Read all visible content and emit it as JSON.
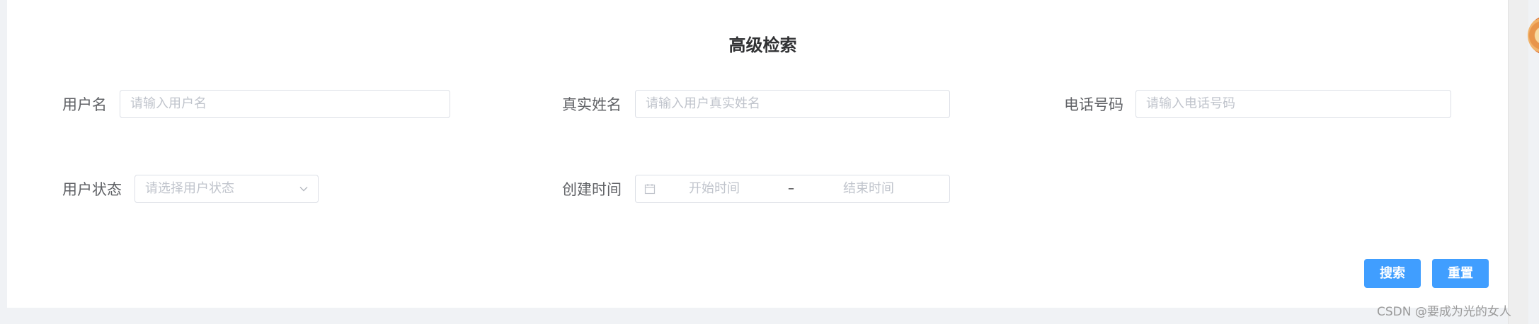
{
  "form": {
    "title": "高级检索",
    "username": {
      "label": "用户名",
      "placeholder": "请输入用户名"
    },
    "realname": {
      "label": "真实姓名",
      "placeholder": "请输入用户真实姓名"
    },
    "phone": {
      "label": "电话号码",
      "placeholder": "请输入电话号码"
    },
    "status": {
      "label": "用户状态",
      "placeholder": "请选择用户状态"
    },
    "created": {
      "label": "创建时间",
      "start_placeholder": "开始时间",
      "separator": "–",
      "end_placeholder": "结束时间"
    }
  },
  "actions": {
    "search": "搜索",
    "reset": "重置"
  },
  "watermark": "CSDN @要成为光的女人",
  "colors": {
    "primary": "#409eff",
    "border": "#dcdfe6",
    "placeholder": "#c0c4cc",
    "label": "#606266"
  },
  "icons": {
    "status_select": "chevron-down-icon",
    "date_range": "calendar-icon"
  }
}
